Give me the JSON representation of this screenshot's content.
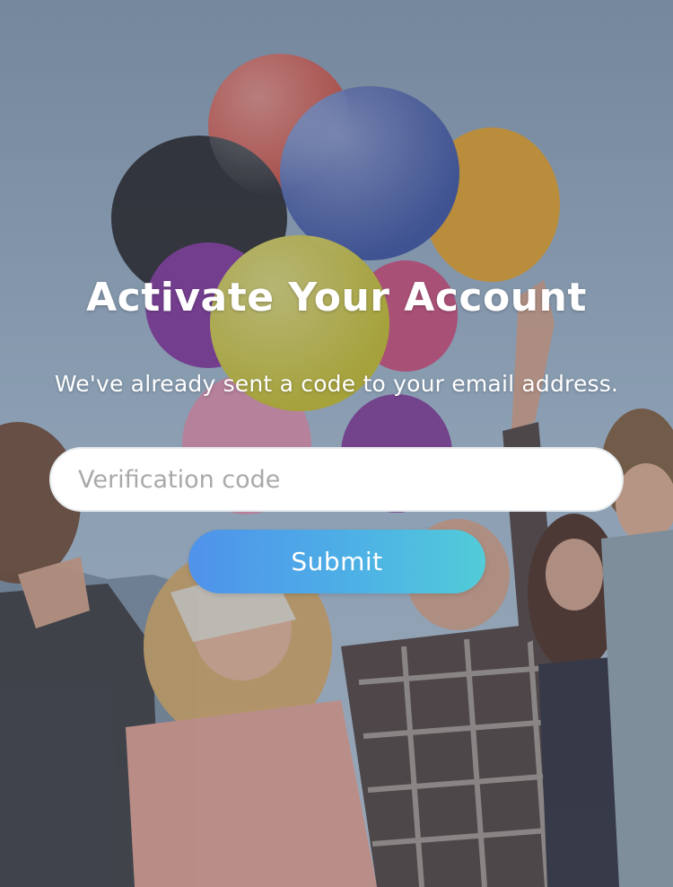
{
  "page": {
    "title": "Activate Your Account",
    "subtitle": "We've already sent a code to your email address."
  },
  "form": {
    "code_value": "",
    "code_placeholder": "Verification code",
    "submit_label": "Submit"
  },
  "background": {
    "description_icon": "balloons-party-photo"
  },
  "colors": {
    "button_gradient_start": "#4f92ea",
    "button_gradient_end": "#52ccd8",
    "text_primary": "#ffffff",
    "placeholder": "#a9a9a9"
  }
}
